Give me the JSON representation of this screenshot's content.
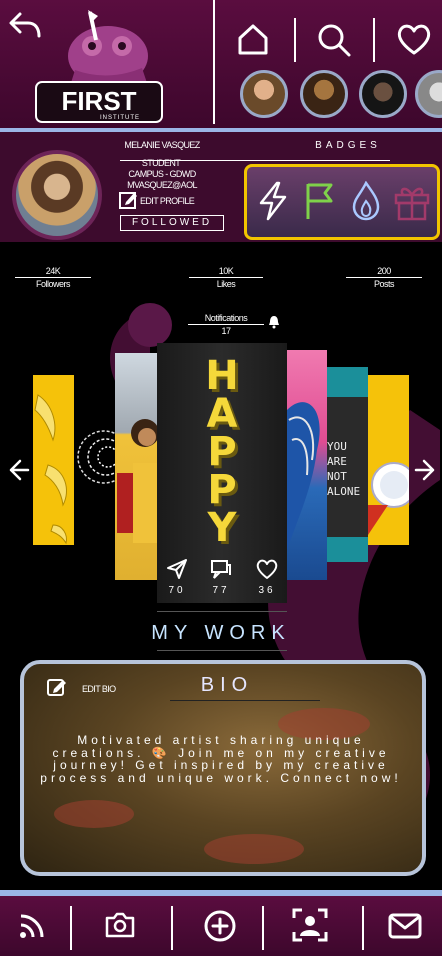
{
  "header": {
    "logo_text": "FIRST",
    "logo_sub": "INSTITUTE",
    "nav_icons": [
      "back-arrow-icon",
      "home-icon",
      "search-icon",
      "heart-icon"
    ]
  },
  "stories": [
    {
      "name": "story-1",
      "color": "#c98a55"
    },
    {
      "name": "story-2",
      "color": "#7a5a3a"
    },
    {
      "name": "story-3",
      "color": "#3a3a3a"
    },
    {
      "name": "story-4",
      "color": "#d9d9d9"
    }
  ],
  "profile": {
    "name": "MELANIE VASQUEZ",
    "role": "STUDENT",
    "campus": "CAMPUS - GDWD",
    "email": "MVASQUEZ@AOL",
    "edit_profile": "EDIT PROFILE",
    "followed": "FOLLOWED",
    "badges_label": "BADGES",
    "badges": [
      "lightning-icon",
      "flag-icon",
      "flame-icon",
      "gift-icon"
    ]
  },
  "stats": {
    "followers_count": "24K",
    "followers_label": "Followers",
    "likes_count": "10K",
    "likes_label": "Likes",
    "posts_count": "200",
    "posts_label": "Posts"
  },
  "notifications": {
    "label": "Notifications",
    "count": "17"
  },
  "featured": {
    "word": "HAPPY",
    "shares": "70",
    "comments": "77",
    "likes": "36"
  },
  "side_card": {
    "sign_text": "YOU ARE NOT ALONE"
  },
  "section_title": "MY WORK",
  "bio": {
    "edit_label": "EDIT BIO",
    "title": "BIO",
    "text": "Motivated artist sharing unique creations. 🎨 Join me on my creative journey! Get inspired by my creative process and unique work. Connect now!"
  },
  "bottom_nav": [
    "feed-icon",
    "camera-icon",
    "add-icon",
    "profile-icon",
    "mail-icon"
  ],
  "colors": {
    "header_bg": "#5a0d3f",
    "rule": "#9bb6e6",
    "badge_border": "#f2c500",
    "accent_text": "#c7e4ff",
    "happy_yellow": "#f5d83a"
  }
}
